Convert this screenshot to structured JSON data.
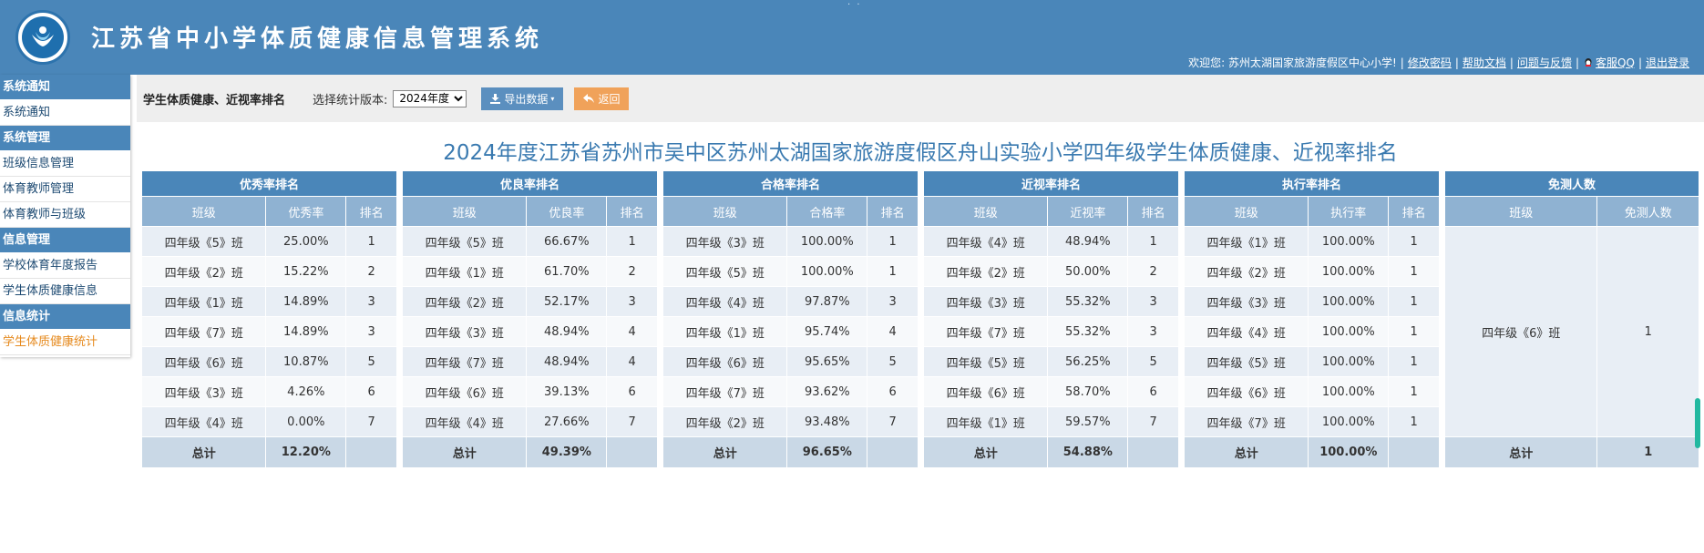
{
  "header": {
    "title": "江苏省中小学体质健康信息管理系统",
    "welcome": "欢迎您: 苏州太湖国家旅游度假区中心小学!",
    "links": [
      "修改密码",
      "帮助文档",
      "问题与反馈",
      "客服QQ",
      "退出登录"
    ]
  },
  "sidebar": [
    {
      "group": "系统通知",
      "items": [
        {
          "label": "系统通知"
        }
      ]
    },
    {
      "group": "系统管理",
      "items": [
        {
          "label": "班级信息管理"
        },
        {
          "label": "体育教师管理"
        },
        {
          "label": "体育教师与班级"
        }
      ]
    },
    {
      "group": "信息管理",
      "items": [
        {
          "label": "学校体育年度报告"
        },
        {
          "label": "学生体质健康信息"
        }
      ]
    },
    {
      "group": "信息统计",
      "items": [
        {
          "label": "学生体质健康统计",
          "active": true
        }
      ]
    }
  ],
  "toolbar": {
    "page_title": "学生体质健康、近视率排名",
    "version_label": "选择统计版本:",
    "version_value": "2024年度",
    "export_label": "导出数据",
    "back_label": "返回"
  },
  "report_title": "2024年度江苏省苏州市吴中区苏州太湖国家旅游度假区舟山实验小学四年级学生体质健康、近视率排名",
  "colors": {
    "header": "#4a86b9",
    "accent_orange": "#e68a1e"
  },
  "tables": [
    {
      "caption": "优秀率排名",
      "headers": [
        "班级",
        "优秀率",
        "排名"
      ],
      "rows": [
        [
          "四年级《5》班",
          "25.00%",
          "1"
        ],
        [
          "四年级《2》班",
          "15.22%",
          "2"
        ],
        [
          "四年级《1》班",
          "14.89%",
          "3"
        ],
        [
          "四年级《7》班",
          "14.89%",
          "3"
        ],
        [
          "四年级《6》班",
          "10.87%",
          "5"
        ],
        [
          "四年级《3》班",
          "4.26%",
          "6"
        ],
        [
          "四年级《4》班",
          "0.00%",
          "7"
        ]
      ],
      "total": [
        "总计",
        "12.20%",
        ""
      ]
    },
    {
      "caption": "优良率排名",
      "headers": [
        "班级",
        "优良率",
        "排名"
      ],
      "rows": [
        [
          "四年级《5》班",
          "66.67%",
          "1"
        ],
        [
          "四年级《1》班",
          "61.70%",
          "2"
        ],
        [
          "四年级《2》班",
          "52.17%",
          "3"
        ],
        [
          "四年级《3》班",
          "48.94%",
          "4"
        ],
        [
          "四年级《7》班",
          "48.94%",
          "4"
        ],
        [
          "四年级《6》班",
          "39.13%",
          "6"
        ],
        [
          "四年级《4》班",
          "27.66%",
          "7"
        ]
      ],
      "total": [
        "总计",
        "49.39%",
        ""
      ]
    },
    {
      "caption": "合格率排名",
      "headers": [
        "班级",
        "合格率",
        "排名"
      ],
      "rows": [
        [
          "四年级《3》班",
          "100.00%",
          "1"
        ],
        [
          "四年级《5》班",
          "100.00%",
          "1"
        ],
        [
          "四年级《4》班",
          "97.87%",
          "3"
        ],
        [
          "四年级《1》班",
          "95.74%",
          "4"
        ],
        [
          "四年级《6》班",
          "95.65%",
          "5"
        ],
        [
          "四年级《7》班",
          "93.62%",
          "6"
        ],
        [
          "四年级《2》班",
          "93.48%",
          "7"
        ]
      ],
      "total": [
        "总计",
        "96.65%",
        ""
      ]
    },
    {
      "caption": "近视率排名",
      "headers": [
        "班级",
        "近视率",
        "排名"
      ],
      "rows": [
        [
          "四年级《4》班",
          "48.94%",
          "1"
        ],
        [
          "四年级《2》班",
          "50.00%",
          "2"
        ],
        [
          "四年级《3》班",
          "55.32%",
          "3"
        ],
        [
          "四年级《7》班",
          "55.32%",
          "3"
        ],
        [
          "四年级《5》班",
          "56.25%",
          "5"
        ],
        [
          "四年级《6》班",
          "58.70%",
          "6"
        ],
        [
          "四年级《1》班",
          "59.57%",
          "7"
        ]
      ],
      "total": [
        "总计",
        "54.88%",
        ""
      ]
    },
    {
      "caption": "执行率排名",
      "headers": [
        "班级",
        "执行率",
        "排名"
      ],
      "rows": [
        [
          "四年级《1》班",
          "100.00%",
          "1"
        ],
        [
          "四年级《2》班",
          "100.00%",
          "1"
        ],
        [
          "四年级《3》班",
          "100.00%",
          "1"
        ],
        [
          "四年级《4》班",
          "100.00%",
          "1"
        ],
        [
          "四年级《5》班",
          "100.00%",
          "1"
        ],
        [
          "四年级《6》班",
          "100.00%",
          "1"
        ],
        [
          "四年级《7》班",
          "100.00%",
          "1"
        ]
      ],
      "total": [
        "总计",
        "100.00%",
        ""
      ]
    },
    {
      "caption": "免测人数",
      "headers": [
        "班级",
        "免测人数"
      ],
      "rows": [
        [
          "四年级《6》班",
          "1"
        ]
      ],
      "total": [
        "总计",
        "1"
      ]
    }
  ]
}
